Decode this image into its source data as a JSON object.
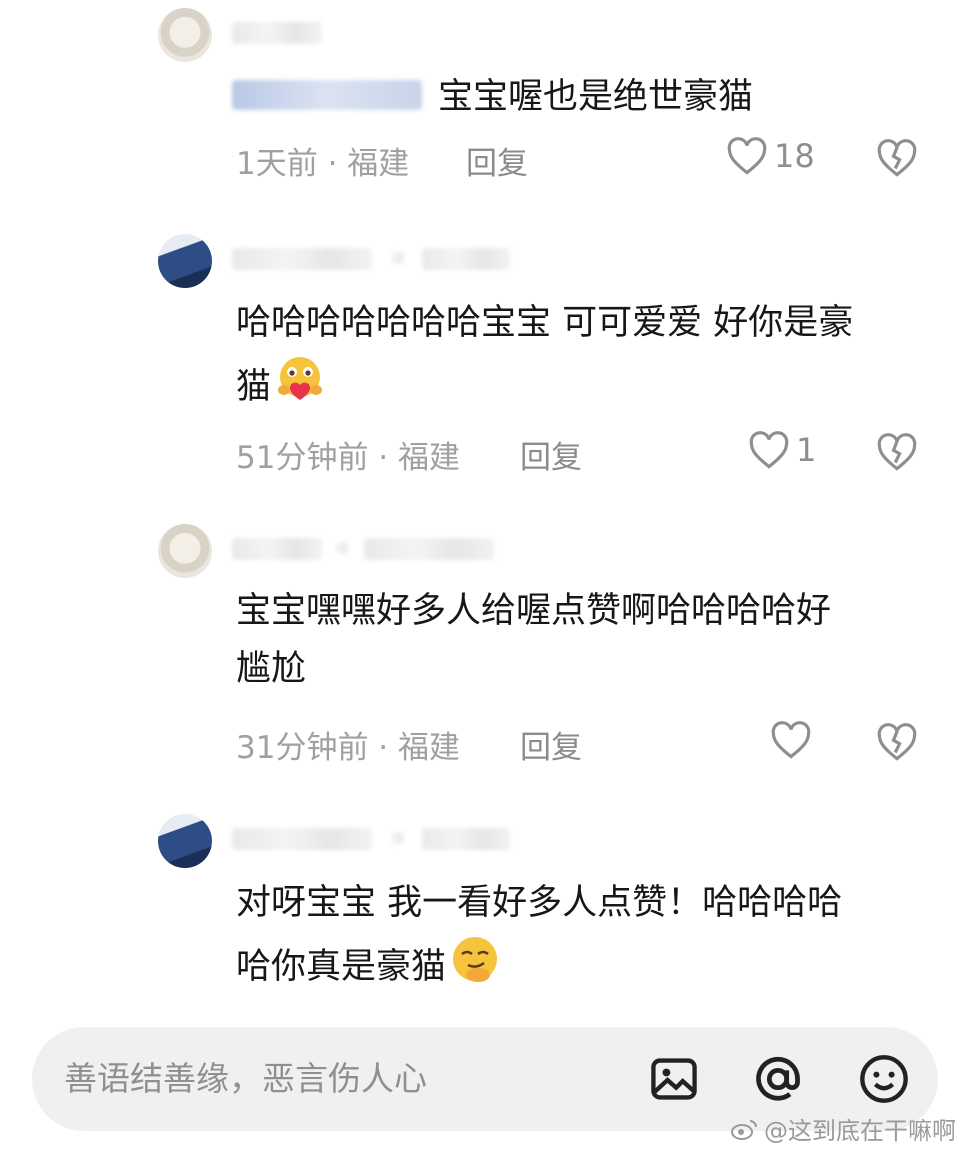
{
  "comments": [
    {
      "text": "宝宝喔也是绝世豪猫",
      "time_location": "1天前 · 福建",
      "reply_label": "回复",
      "likes": "18",
      "avatar": "light"
    },
    {
      "text": "哈哈哈哈哈哈哈宝宝 可可爱爱 好你是豪\n猫",
      "emoji": "hugging-heart-emoji",
      "time_location": "51分钟前 · 福建",
      "reply_label": "回复",
      "likes": "1",
      "avatar": "dark"
    },
    {
      "text": "宝宝嘿嘿好多人给喔点赞啊哈哈哈哈好\n尴尬",
      "time_location": "31分钟前 · 福建",
      "reply_label": "回复",
      "likes": "",
      "avatar": "light"
    },
    {
      "text": "对呀宝宝 我一看好多人点赞！哈哈哈哈\n哈你真是豪猫",
      "emoji": "smirk-hand-emoji",
      "avatar": "dark"
    }
  ],
  "input": {
    "placeholder": "善语结善缘，恶言伤人心"
  },
  "icons": {
    "like": "heart-outline-icon",
    "dislike": "broken-heart-icon",
    "image": "image-icon",
    "mention": "at-icon",
    "emoji": "smiley-icon"
  },
  "watermark": "@这到底在干嘛啊"
}
